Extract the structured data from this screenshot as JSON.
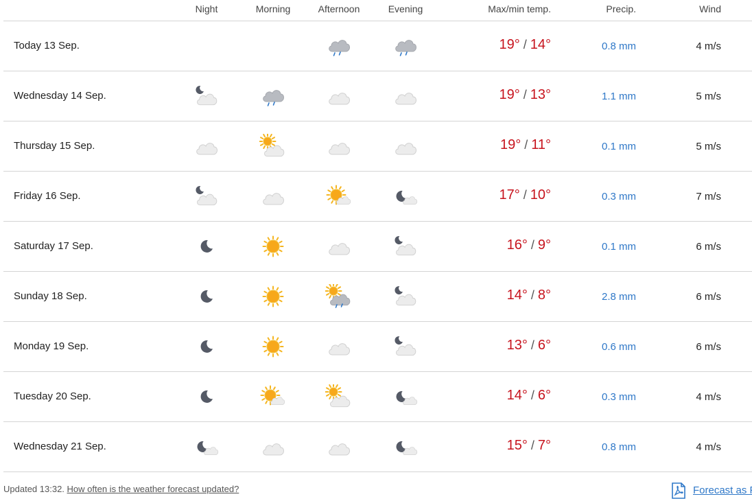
{
  "columns": {
    "night": "Night",
    "morning": "Morning",
    "afternoon": "Afternoon",
    "evening": "Evening",
    "temp": "Max/min temp.",
    "precip": "Precip.",
    "wind": "Wind"
  },
  "rows": [
    {
      "day": "Today 13 Sep.",
      "icons": [
        "",
        "",
        "cloud-rain",
        "cloud-rain"
      ],
      "max": "19°",
      "min": "14°",
      "precip": "0.8 mm",
      "wind": "4 m/s"
    },
    {
      "day": "Wednesday 14 Sep.",
      "icons": [
        "moon-cloud",
        "cloud-rain",
        "cloud",
        "cloud"
      ],
      "max": "19°",
      "min": "13°",
      "precip": "1.1 mm",
      "wind": "5 m/s"
    },
    {
      "day": "Thursday 15 Sep.",
      "icons": [
        "cloud",
        "sun-cloud",
        "cloud",
        "cloud"
      ],
      "max": "19°",
      "min": "11°",
      "precip": "0.1 mm",
      "wind": "5 m/s"
    },
    {
      "day": "Friday 16 Sep.",
      "icons": [
        "moon-cloud",
        "cloud",
        "sun-partly",
        "moon-partly"
      ],
      "max": "17°",
      "min": "10°",
      "precip": "0.3 mm",
      "wind": "7 m/s"
    },
    {
      "day": "Saturday 17 Sep.",
      "icons": [
        "moon",
        "sun",
        "cloud",
        "moon-cloud"
      ],
      "max": "16°",
      "min": "9°",
      "precip": "0.1 mm",
      "wind": "6 m/s"
    },
    {
      "day": "Sunday 18 Sep.",
      "icons": [
        "moon",
        "sun",
        "sun-cloud-rain",
        "moon-cloud"
      ],
      "max": "14°",
      "min": "8°",
      "precip": "2.8 mm",
      "wind": "6 m/s"
    },
    {
      "day": "Monday 19 Sep.",
      "icons": [
        "moon",
        "sun",
        "cloud",
        "moon-cloud"
      ],
      "max": "13°",
      "min": "6°",
      "precip": "0.6 mm",
      "wind": "6 m/s"
    },
    {
      "day": "Tuesday 20 Sep.",
      "icons": [
        "moon",
        "sun-partly",
        "sun-cloud",
        "moon-partly"
      ],
      "max": "14°",
      "min": "6°",
      "precip": "0.3 mm",
      "wind": "4 m/s"
    },
    {
      "day": "Wednesday 21 Sep.",
      "icons": [
        "moon-partly",
        "cloud",
        "cloud",
        "moon-partly"
      ],
      "max": "15°",
      "min": "7°",
      "precip": "0.8 mm",
      "wind": "4 m/s"
    }
  ],
  "footer": {
    "updated": "Updated 13:32.",
    "link": "How often is the weather forecast updated?",
    "pdf_link": "Forecast as PDF"
  },
  "colors": {
    "temp": "#c7131d",
    "precip": "#2f78c8",
    "divider": "#d4d4d4"
  }
}
